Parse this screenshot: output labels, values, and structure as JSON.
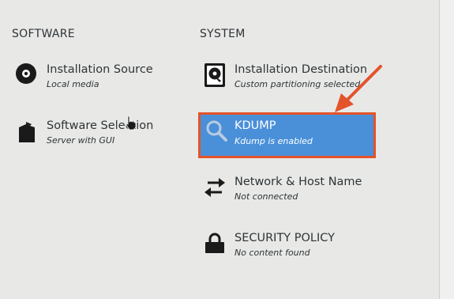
{
  "software": {
    "heading": "SOFTWARE",
    "items": [
      {
        "title": "Installation Source",
        "status": "Local media",
        "icon": "disc-icon"
      },
      {
        "title": "Software Selection",
        "status": "Server with GUI",
        "icon": "package-icon"
      }
    ]
  },
  "system": {
    "heading": "SYSTEM",
    "items": [
      {
        "title": "Installation Destination",
        "status": "Custom partitioning selected",
        "icon": "harddisk-icon"
      },
      {
        "title": "KDUMP",
        "status": "Kdump is enabled",
        "icon": "magnifier-icon",
        "selected": true
      },
      {
        "title": "Network & Host Name",
        "status": "Not connected",
        "icon": "network-arrows-icon"
      },
      {
        "title": "SECURITY POLICY",
        "status": "No content found",
        "icon": "lock-icon"
      }
    ]
  },
  "colors": {
    "background": "#e8e8e7",
    "selected": "#4a90d9",
    "highlight_border": "#e4532a",
    "annotation_arrow": "#e4532a"
  }
}
